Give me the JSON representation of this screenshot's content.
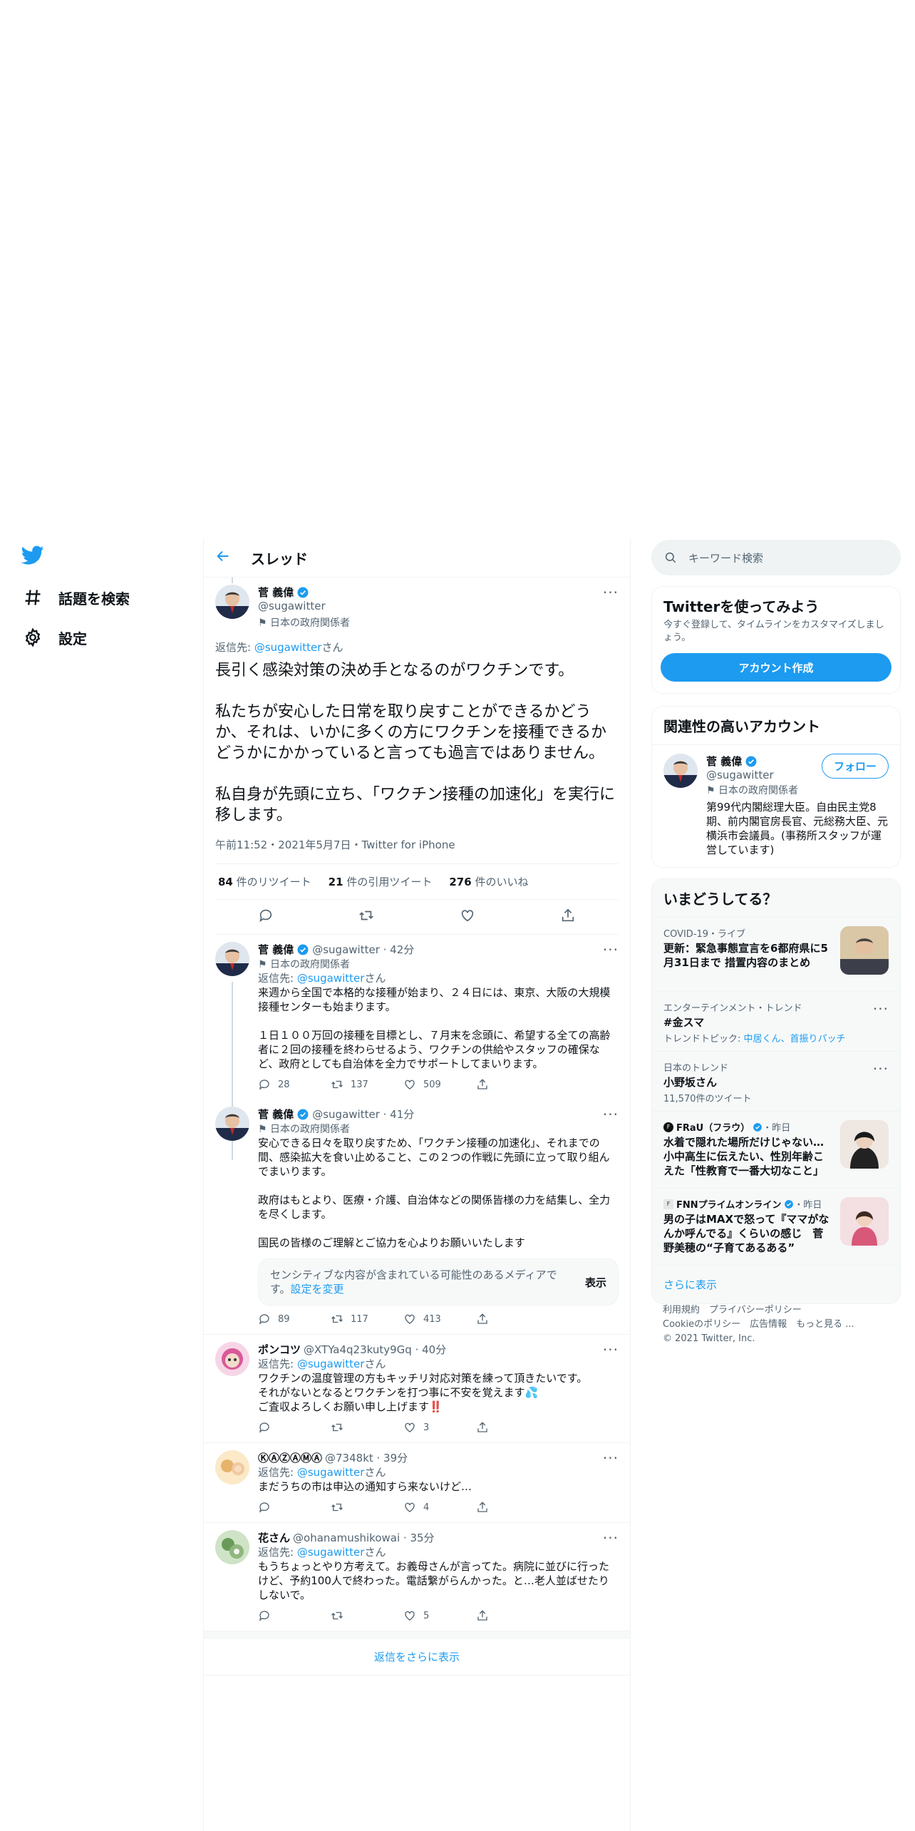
{
  "nav": {
    "explore": "話題を検索",
    "settings": "設定"
  },
  "header": {
    "title": "スレッド"
  },
  "main_tweet": {
    "name": "菅 義偉",
    "handle": "@sugawitter",
    "label": "日本の政府関係者",
    "reply_prefix": "返信先: ",
    "reply_handle": "@sugawitter",
    "reply_suffix": "さん",
    "text": "長引く感染対策の決め手となるのがワクチンです。\n\n私たちが安心した日常を取り戻すことができるかどうか、それは、いかに多くの方にワクチンを接種できるかどうかにかかっていると言っても過言ではありません。\n\n私自身が先頭に立ち、「ワクチン接種の加速化」を実行に移します。",
    "meta": "午前11:52・2021年5月7日・Twitter for iPhone",
    "retweets_count": "84",
    "retweets_label": "件のリツイート",
    "quotes_count": "21",
    "quotes_label": "件の引用ツイート",
    "likes_count": "276",
    "likes_label": "件のいいね"
  },
  "replies": [
    {
      "name": "菅 義偉",
      "handle": "@sugawitter · 42分",
      "label": "日本の政府関係者",
      "reply_prefix": "返信先: ",
      "reply_handle": "@sugawitter",
      "reply_suffix": "さん",
      "text": "来週から全国で本格的な接種が始まり、２４日には、東京、大阪の大規模接種センターも始まります。\n\n１日１００万回の接種を目標とし、７月末を念頭に、希望する全ての高齢者に２回の接種を終わらせるよう、ワクチンの供給やスタッフの確保など、政府としても自治体を全力でサポートしてまいります。",
      "replies": "28",
      "retweets": "137",
      "likes": "509"
    },
    {
      "name": "菅 義偉",
      "handle": "@sugawitter · 41分",
      "label": "日本の政府関係者",
      "text": "安心できる日々を取り戻すため、「ワクチン接種の加速化」、それまでの間、感染拡大を食い止めること、この２つの作戦に先頭に立って取り組んでまいります。\n\n政府はもとより、医療・介護、自治体などの関係皆様の力を結集し、全力を尽くします。\n\n国民の皆様のご理解とご協力を心よりお願いいたします",
      "sensitive_text": "センシティブな内容が含まれている可能性のあるメディアです。",
      "sensitive_link": "設定を変更",
      "sensitive_show": "表示",
      "replies": "89",
      "retweets": "117",
      "likes": "413"
    },
    {
      "name": "ポンコツ",
      "handle": "@XTYa4q23kuty9Gq · 40分",
      "reply_prefix": "返信先: ",
      "reply_handle": "@sugawitter",
      "reply_suffix": "さん",
      "text": "ワクチンの温度管理の方もキッチリ対応対策を練って頂きたいです。\nそれがないとなるとワクチンを打つ事に不安を覚えます💦\nご査収よろしくお願い申し上げます‼️",
      "replies": "",
      "retweets": "",
      "likes": "3"
    },
    {
      "name": "ⓀⒶⓏⒶⓂⒶ",
      "handle": "@7348kt · 39分",
      "reply_prefix": "返信先: ",
      "reply_handle": "@sugawitter",
      "reply_suffix": "さん",
      "text": "まだうちの市は申込の通知すら来ないけど…",
      "replies": "",
      "retweets": "",
      "likes": "4"
    },
    {
      "name": "花さん",
      "handle": "@ohanamushikowai · 35分",
      "reply_prefix": "返信先: ",
      "reply_handle": "@sugawitter",
      "reply_suffix": "さん",
      "text": "もうちょっとやり方考えて。お義母さんが言ってた。病院に並びに行ったけど、予約100人で終わった。電話繋がらんかった。と…老人並ばせたりしないで。",
      "replies": "",
      "retweets": "",
      "likes": "5"
    }
  ],
  "more_replies": "返信をさらに表示",
  "search": {
    "placeholder": "キーワード検索"
  },
  "signup": {
    "title": "Twitterを使ってみよう",
    "desc": "今すぐ登録して、タイムラインをカスタマイズしましょう。",
    "button": "アカウント作成"
  },
  "relevant": {
    "title": "関連性の高いアカウント",
    "name": "菅 義偉",
    "handle": "@sugawitter",
    "label": "日本の政府関係者",
    "follow": "フォロー",
    "bio": "第99代内閣総理大臣。自由民主党8期、前内閣官房長官、元総務大臣、元横浜市会議員。(事務所スタッフが運営しています)"
  },
  "trends": {
    "title": "いまどうしてる？",
    "items": [
      {
        "cat": "COVID-19・ライブ",
        "title": "更新：緊急事態宣言を6都府県に5月31日まで 措置内容のまとめ"
      },
      {
        "cat": "エンターテインメント・トレンド",
        "title": "#金スマ",
        "sub_prefix": "トレンドトピック: ",
        "sub_links": "中居くん、首振りパッチ"
      },
      {
        "cat": "日本のトレンド",
        "title": "小野坂さん",
        "sub": "11,570件のツイート"
      },
      {
        "source": "FRaU（フラウ）",
        "time": "・昨日",
        "title": "水着で隠れた場所だけじゃない…小中高生に伝えたい、性別年齢こえた「性教育で一番大切なこと」"
      },
      {
        "source": "FNNプライムオンライン",
        "time": "・昨日",
        "title": "男の子はMAXで怒って『ママがなんか呼んでる』くらいの感じ　菅野美穂の“子育てあるある”"
      }
    ],
    "more": "さらに表示"
  },
  "footer": {
    "line1": "利用規約　プライバシーポリシー",
    "line2": "Cookieのポリシー　広告情報　もっと見る ...",
    "line3": "© 2021 Twitter, Inc."
  },
  "colors": {
    "accent": "#1d9bf0",
    "like_red": "#e0245e"
  }
}
